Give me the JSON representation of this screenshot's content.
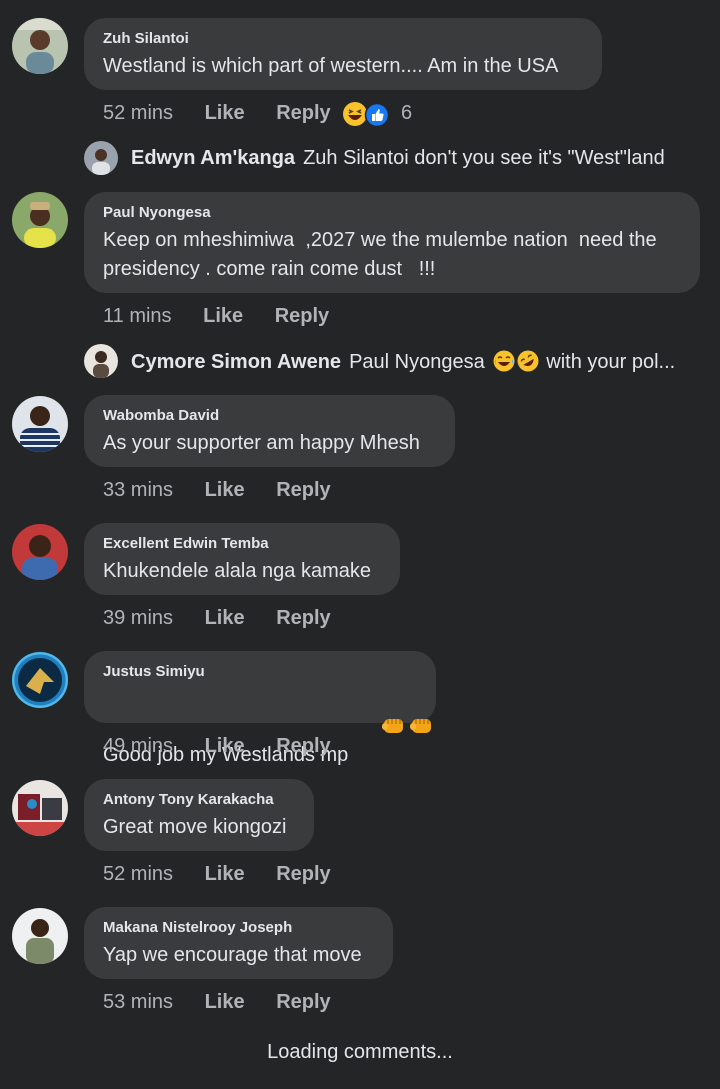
{
  "comments": [
    {
      "author": "Zuh Silantoi",
      "text": "Westland is which part of western.... Am in the USA",
      "time": "52 mins",
      "like": "Like",
      "reply": "Reply",
      "reaction_count": "6",
      "reaction_icons": [
        "laugh-emoji",
        "like-icon"
      ]
    },
    {
      "author": "Paul Nyongesa",
      "text_line1": "Keep on mheshimiwa  ,2027 we the mulembe nation  need the",
      "text_line2": "presidency . come rain come dust   !!!",
      "time": "11 mins",
      "like": "Like",
      "reply": "Reply"
    },
    {
      "author": "Wabomba David",
      "text": "As your supporter am happy Mhesh",
      "time": "33 mins",
      "like": "Like",
      "reply": "Reply"
    },
    {
      "author": "Excellent Edwin Temba",
      "text": "Khukendele alala nga kamake",
      "time": "39 mins",
      "like": "Like",
      "reply": "Reply"
    },
    {
      "author": "Justus Simiyu",
      "text": "Good job my Westlands mp",
      "emoji": [
        "fist-emoji",
        "fist-emoji"
      ],
      "time": "49 mins",
      "like": "Like",
      "reply": "Reply"
    },
    {
      "author": "Antony Tony Karakacha",
      "text": "Great move kiongozi",
      "time": "52 mins",
      "like": "Like",
      "reply": "Reply"
    },
    {
      "author": "Makana Nistelrooy Joseph",
      "text": "Yap we encourage that move",
      "time": "53 mins",
      "like": "Like",
      "reply": "Reply"
    }
  ],
  "replies": [
    {
      "author": "Edwyn Am'kanga",
      "text": "Zuh Silantoi don't you see it's \"West\"land"
    },
    {
      "author": "Cymore Simon Awene",
      "text_before": "Paul Nyongesa",
      "emoji": [
        "tears-of-joy-emoji",
        "rofl-emoji"
      ],
      "text_after": "with your pol..."
    }
  ],
  "footer": {
    "loading": "Loading comments..."
  },
  "colors": {
    "background": "#242526",
    "bubble": "#3a3b3c",
    "text": "#e4e6eb",
    "meta": "#b0b3b8",
    "like_blue": "#1877f2"
  }
}
